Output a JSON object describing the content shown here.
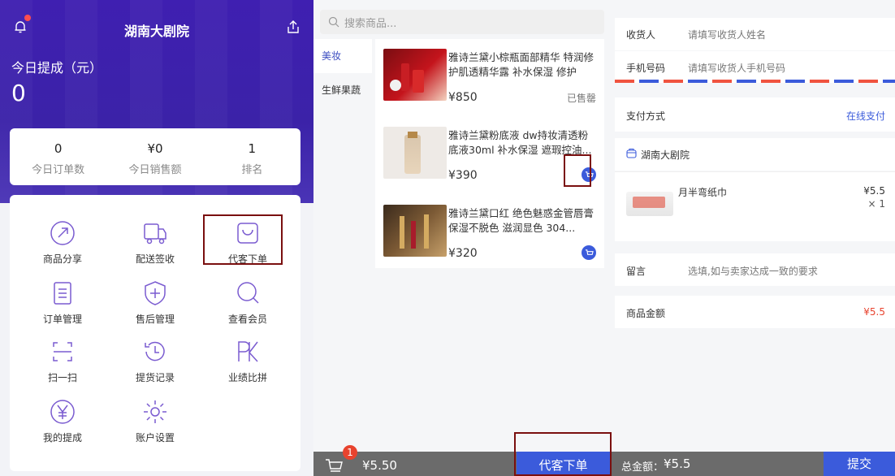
{
  "panel_dashboard": {
    "title": "湖南大剧院",
    "today_label": "今日提成（元）",
    "today_value": "0",
    "stats": [
      {
        "value": "0",
        "label": "今日订单数"
      },
      {
        "value": "¥0",
        "label": "今日销售额"
      },
      {
        "value": "1",
        "label": "排名"
      }
    ],
    "grid": [
      {
        "label": "商品分享",
        "icon": "share-arrow-icon"
      },
      {
        "label": "配送签收",
        "icon": "delivery-truck-icon"
      },
      {
        "label": "代客下单",
        "icon": "shopping-bag-icon"
      },
      {
        "label": "订单管理",
        "icon": "order-list-icon"
      },
      {
        "label": "售后管理",
        "icon": "after-sales-shield-icon"
      },
      {
        "label": "查看会员",
        "icon": "search-member-icon"
      },
      {
        "label": "扫一扫",
        "icon": "scan-icon"
      },
      {
        "label": "提货记录",
        "icon": "history-clock-icon"
      },
      {
        "label": "业绩比拼",
        "icon": "pk-icon"
      },
      {
        "label": "我的提成",
        "icon": "yen-circle-icon"
      },
      {
        "label": "账户设置",
        "icon": "settings-gear-icon"
      }
    ]
  },
  "panel_shop": {
    "search_placeholder": "搜索商品...",
    "categories": [
      "美妆",
      "生鲜果蔬"
    ],
    "products": [
      {
        "name": "雅诗兰黛小棕瓶面部精华 特润修护肌透精华露 补水保湿 修护",
        "price": "¥850",
        "status": "已售罄"
      },
      {
        "name": "雅诗兰黛粉底液 dw持妆清透粉底液30ml 补水保湿 遮瑕控油...",
        "price": "¥390",
        "status": ""
      },
      {
        "name": "雅诗兰黛口红 绝色魅惑金管唇膏 保湿不脱色 滋润显色 304...",
        "price": "¥320",
        "status": ""
      }
    ],
    "cart_count": "1",
    "cart_total": "¥5.50",
    "order_button": "代客下单"
  },
  "panel_checkout": {
    "receiver_label": "收货人",
    "receiver_placeholder": "请填写收货人姓名",
    "phone_label": "手机号码",
    "phone_placeholder": "请填写收货人手机号码",
    "payment_label": "支付方式",
    "payment_value": "在线支付",
    "store_name": "湖南大剧院",
    "item_name": "月半弯纸巾",
    "item_price": "¥5.5",
    "item_qty": "× 1",
    "note_label": "留言",
    "note_placeholder": "选填,如与卖家达成一致的要求",
    "amount_label": "商品金额",
    "amount_value": "¥5.5",
    "total_label": "总金额：",
    "total_value": "¥5.5",
    "submit_label": "提交"
  },
  "colors": {
    "purple": "#3f1fb1",
    "blue": "#3b5bdb",
    "red": "#e8432e",
    "dark_red_frame": "#7a0f0f"
  }
}
